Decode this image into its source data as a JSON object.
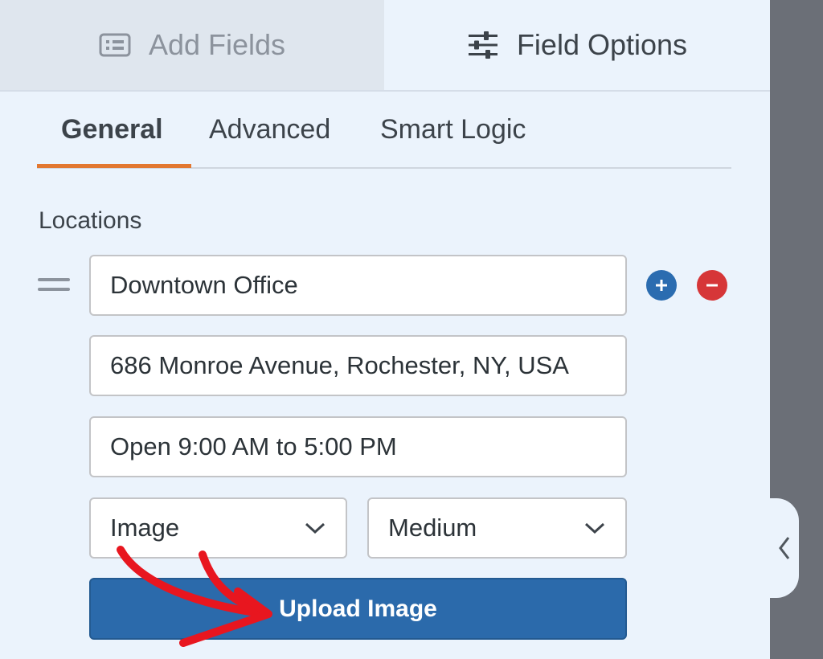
{
  "top_tabs": {
    "add_fields": "Add Fields",
    "field_options": "Field Options"
  },
  "sub_tabs": {
    "general": "General",
    "advanced": "Advanced",
    "smart_logic": "Smart Logic"
  },
  "section_label": "Locations",
  "location": {
    "name": "Downtown Office",
    "address": "686 Monroe Avenue, Rochester, NY, USA",
    "hours": "Open 9:00 AM to 5:00 PM",
    "media_type": "Image",
    "size": "Medium"
  },
  "upload_button": "Upload Image",
  "colors": {
    "accent_orange": "#e27730",
    "primary_blue": "#2b6aab",
    "remove_red": "#d63638",
    "annotation_red": "#e8161f"
  },
  "icons": {
    "add_fields": "list-form-icon",
    "field_options": "sliders-icon",
    "drag": "drag-handle-icon",
    "add": "plus-circle-icon",
    "remove": "minus-circle-icon",
    "dropdown": "chevron-down-icon",
    "collapse": "chevron-left-icon"
  }
}
